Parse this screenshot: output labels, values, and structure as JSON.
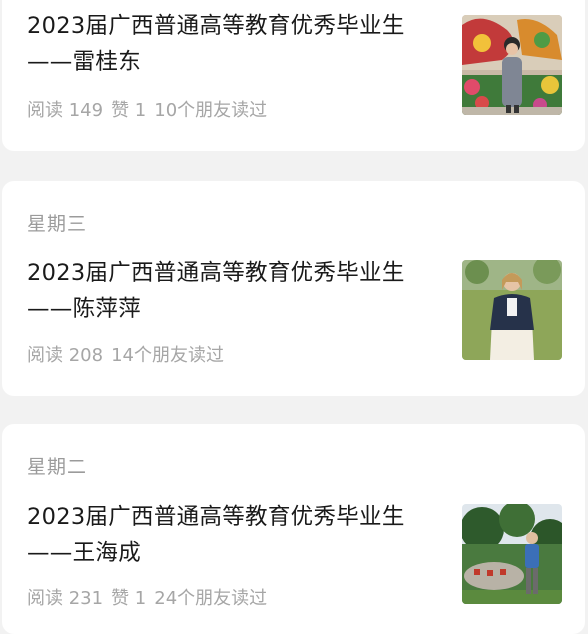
{
  "articles": [
    {
      "day": "",
      "title": "2023届广西普通高等教育优秀毕业生——雷桂东",
      "reads": "阅读 149",
      "likes": "赞 1",
      "friends": "10个朋友读过",
      "photo": "photo-man-in-coat-before-flower-display"
    },
    {
      "day": "星期三",
      "title": "2023届广西普通高等教育优秀毕业生——陈萍萍",
      "reads": "阅读 208",
      "likes": "",
      "friends": "14个朋友读过",
      "photo": "photo-woman-in-denim-jacket-on-lawn"
    },
    {
      "day": "星期二",
      "title": "2023届广西普通高等教育优秀毕业生——王海成",
      "reads": "阅读 231",
      "likes": "赞 1",
      "friends": "24个朋友读过",
      "photo": "photo-man-by-engraved-stone-in-garden"
    }
  ]
}
